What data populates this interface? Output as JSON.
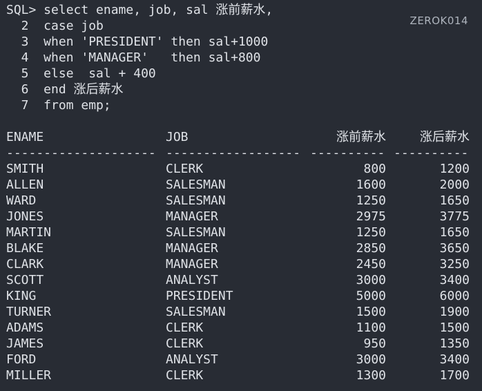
{
  "watermark": "ZEROK014",
  "sql_lines": [
    "SQL> select ename, job, sal 涨前薪水,",
    "  2  case job",
    "  3  when 'PRESIDENT' then sal+1000",
    "  4  when 'MANAGER'   then sal+800",
    "  5  else  sal + 400",
    "  6  end 涨后薪水",
    "  7  from emp;"
  ],
  "result": {
    "headers": [
      "ENAME",
      "JOB",
      "涨前薪水",
      "涨后薪水"
    ],
    "separators": [
      "--------------------",
      "------------------",
      "----------",
      "----------"
    ],
    "rows": [
      [
        "SMITH",
        "CLERK",
        "800",
        "1200"
      ],
      [
        "ALLEN",
        "SALESMAN",
        "1600",
        "2000"
      ],
      [
        "WARD",
        "SALESMAN",
        "1250",
        "1650"
      ],
      [
        "JONES",
        "MANAGER",
        "2975",
        "3775"
      ],
      [
        "MARTIN",
        "SALESMAN",
        "1250",
        "1650"
      ],
      [
        "BLAKE",
        "MANAGER",
        "2850",
        "3650"
      ],
      [
        "CLARK",
        "MANAGER",
        "2450",
        "3250"
      ],
      [
        "SCOTT",
        "ANALYST",
        "3000",
        "3400"
      ],
      [
        "KING",
        "PRESIDENT",
        "5000",
        "6000"
      ],
      [
        "TURNER",
        "SALESMAN",
        "1500",
        "1900"
      ],
      [
        "ADAMS",
        "CLERK",
        "1100",
        "1500"
      ],
      [
        "JAMES",
        "CLERK",
        "950",
        "1350"
      ],
      [
        "FORD",
        "ANALYST",
        "3000",
        "3400"
      ],
      [
        "MILLER",
        "CLERK",
        "1300",
        "1700"
      ]
    ]
  }
}
